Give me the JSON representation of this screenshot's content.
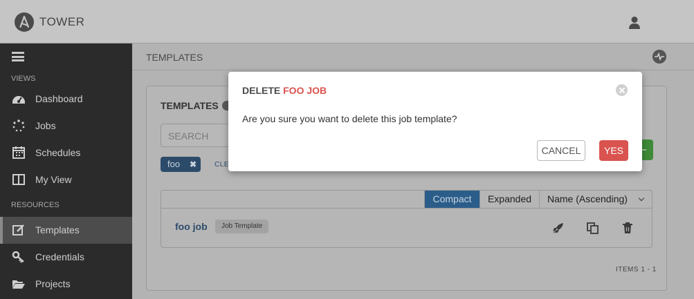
{
  "header": {
    "brand": "TOWER",
    "icons": {
      "logo": "ansible-logo-icon",
      "user": "user-icon"
    }
  },
  "sidebar": {
    "menu_icon": "hamburger-icon",
    "sections": {
      "views": "VIEWS",
      "resources": "RESOURCES"
    },
    "items": [
      {
        "label": "Dashboard",
        "icon": "dashboard-icon"
      },
      {
        "label": "Jobs",
        "icon": "jobs-spinner-icon"
      },
      {
        "label": "Schedules",
        "icon": "calendar-icon"
      },
      {
        "label": "My View",
        "icon": "columns-icon"
      },
      {
        "label": "Templates",
        "icon": "edit-icon",
        "active": true
      },
      {
        "label": "Credentials",
        "icon": "key-icon"
      },
      {
        "label": "Projects",
        "icon": "folder-icon"
      }
    ]
  },
  "main": {
    "title": "TEMPLATES",
    "activity_icon": "activity-stream-icon",
    "panel": {
      "title": "TEMPLATES",
      "search_placeholder": "SEARCH",
      "tag": "foo",
      "clear": "CLE",
      "views": {
        "compact": "Compact",
        "expanded": "Expanded"
      },
      "sort": "Name (Ascending)",
      "rows": [
        {
          "name": "foo job",
          "type": "Job Template"
        }
      ],
      "items_count": "ITEMS  1 - 1"
    }
  },
  "modal": {
    "title_prefix": "DELETE",
    "title_name": "FOO JOB",
    "body": "Are you sure you want to delete this job template?",
    "cancel": "CANCEL",
    "confirm": "YES"
  },
  "colors": {
    "danger": "#d9534f",
    "primary": "#2b5d8a",
    "success": "#3e8a38",
    "sidebar": "#2b2b2b"
  }
}
